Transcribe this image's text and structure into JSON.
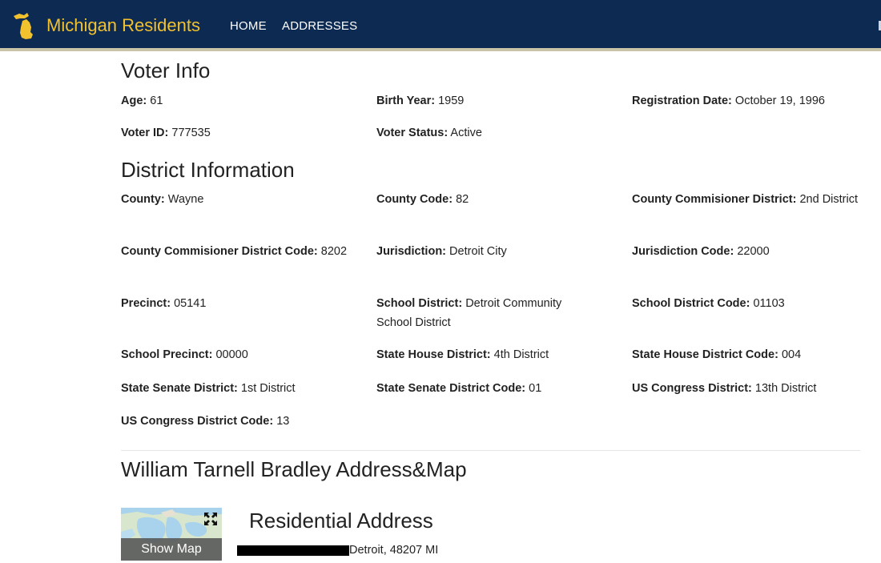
{
  "header": {
    "brand_name": "Michigan Residents",
    "nav": [
      {
        "label": "HOME"
      },
      {
        "label": "ADDRESSES"
      }
    ],
    "colors": {
      "bar": "#0d2a52",
      "brand": "#f2c12e"
    },
    "logo_icon": "michigan-state-shape-icon"
  },
  "voter_info": {
    "title": "Voter Info",
    "fields": [
      {
        "label": "Age:",
        "value": "61"
      },
      {
        "label": "Birth Year:",
        "value": "1959"
      },
      {
        "label": "Registration Date:",
        "value": "October 19, 1996"
      },
      {
        "label": "Voter ID:",
        "value": "777535"
      },
      {
        "label": "Voter Status:",
        "value": "Active"
      }
    ]
  },
  "district_info": {
    "title": "District Information",
    "fields": [
      {
        "label": "County:",
        "value": "Wayne"
      },
      {
        "label": "County Code:",
        "value": "82"
      },
      {
        "label": "County Commisioner District:",
        "value": "2nd District"
      },
      {
        "label": "County Commisioner District Code:",
        "value": "8202"
      },
      {
        "label": "Jurisdiction:",
        "value": "Detroit City"
      },
      {
        "label": "Jurisdiction Code:",
        "value": "22000"
      },
      {
        "label": "Precinct:",
        "value": "05141"
      },
      {
        "label": "School District:",
        "value": "Detroit Community School District"
      },
      {
        "label": "School District Code:",
        "value": "01103"
      },
      {
        "label": "School Precinct:",
        "value": "00000"
      },
      {
        "label": "State House District:",
        "value": "4th District"
      },
      {
        "label": "State House District Code:",
        "value": "004"
      },
      {
        "label": "State Senate District:",
        "value": "1st District"
      },
      {
        "label": "State Senate District Code:",
        "value": "01"
      },
      {
        "label": "US Congress District:",
        "value": "13th District"
      },
      {
        "label": "US Congress District Code:",
        "value": "13"
      }
    ]
  },
  "address_section": {
    "title": "William Tarnell Bradley Address&Map",
    "map_button": "Show Map",
    "expand_icon": "expand-arrows-icon",
    "residential_title": "Residential Address",
    "address_visible": "Detroit, 48207 MI"
  }
}
